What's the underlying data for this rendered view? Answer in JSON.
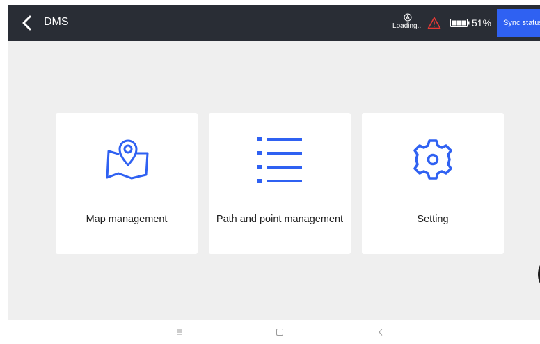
{
  "header": {
    "title": "DMS",
    "status_text": "Loading...",
    "battery_percent": "51%",
    "battery_level": 0.51,
    "sync_button_label": "Sync status"
  },
  "cards": [
    {
      "label": "Map management",
      "icon": "map-pin-icon"
    },
    {
      "label": "Path and point management",
      "icon": "list-icon"
    },
    {
      "label": "Setting",
      "icon": "gear-icon"
    }
  ],
  "colors": {
    "accent": "#2f61f2",
    "topbar": "#292d35",
    "background": "#efefef",
    "warning": "#e53935"
  },
  "navbar": {
    "icons": [
      "menu-icon",
      "home-square-icon",
      "back-chevron-icon"
    ]
  }
}
